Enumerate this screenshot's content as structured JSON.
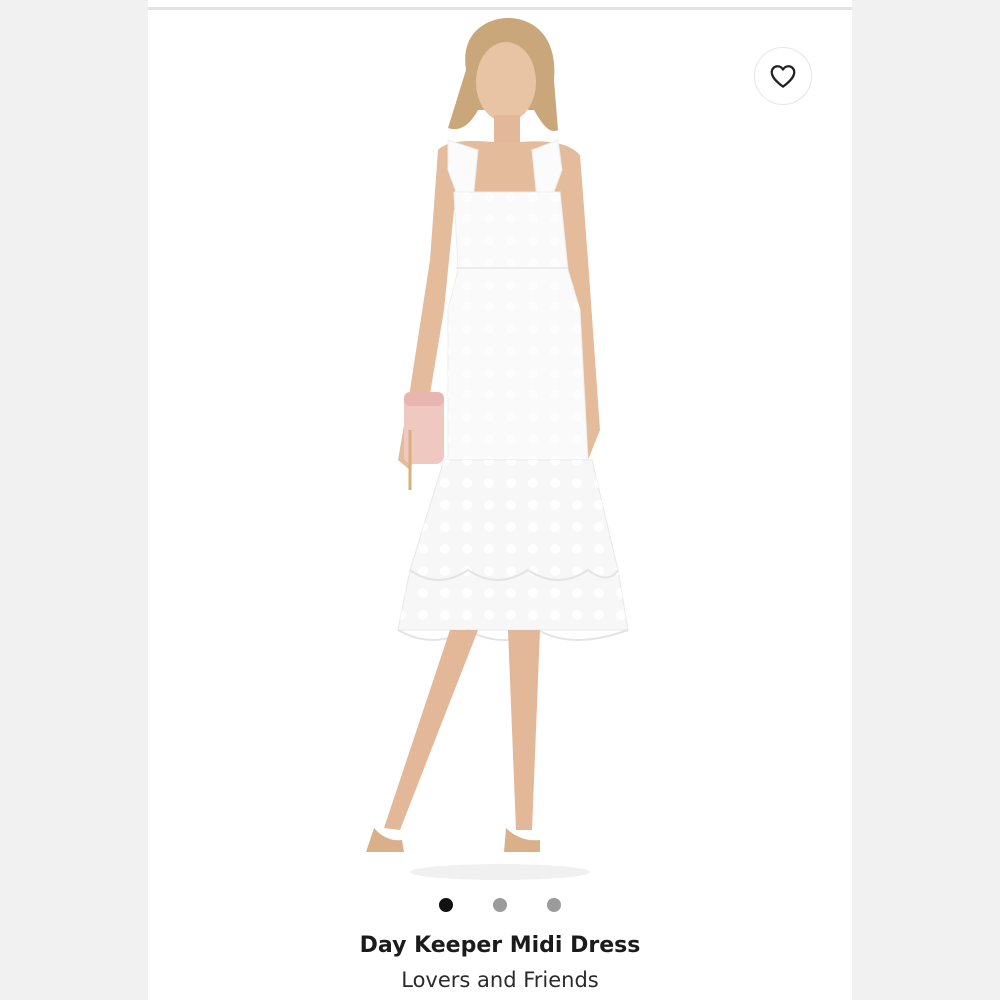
{
  "product": {
    "name": "Day Keeper Midi Dress",
    "brand": "Lovers and Friends"
  },
  "gallery": {
    "image_icon": "product-photo-model-in-white-dress",
    "dots": [
      {
        "state": "active"
      },
      {
        "state": "inactive"
      },
      {
        "state": "inactive"
      }
    ]
  },
  "favorite": {
    "icon": "heart-outline-icon"
  },
  "colors": {
    "dot_active": "#111111",
    "dot_inactive": "#9b9b9b",
    "background": "#ffffff"
  }
}
